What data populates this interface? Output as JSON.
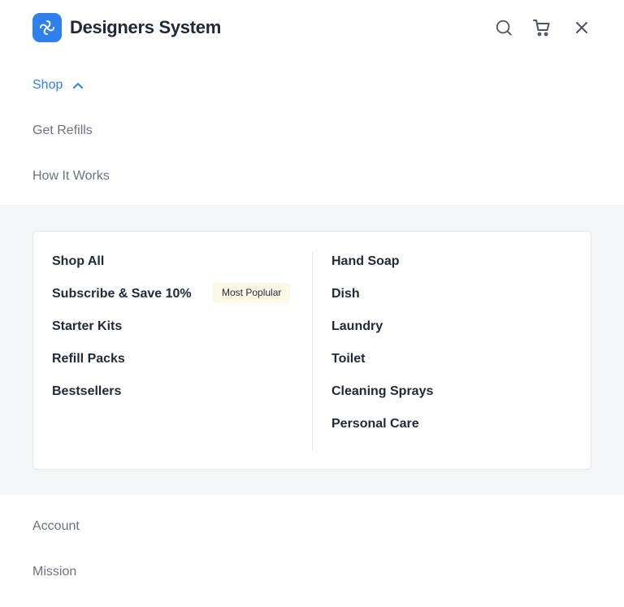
{
  "header": {
    "brand": "Designers System",
    "icons": [
      "logo-icon",
      "search-icon",
      "cart-icon",
      "close-icon"
    ]
  },
  "nav": {
    "shop": "Shop",
    "get_refills": "Get Refills",
    "how_it_works": "How It Works",
    "account": "Account",
    "mission": "Mission"
  },
  "menu": {
    "left": [
      "Shop All",
      "Subscribe & Save 10%",
      "Starter Kits",
      "Refill Packs",
      "Bestsellers"
    ],
    "badge": "Most Poplular",
    "right": [
      "Hand Soap",
      "Dish",
      "Laundry",
      "Toilet",
      "Cleaning Sprays",
      "Personal Care"
    ]
  },
  "colors": {
    "accent": "#2f80ed",
    "panel_bg": "#f4f5f7",
    "badge_bg": "#fdf8e6",
    "text_dark": "#1f2937",
    "text_muted": "#6b7280"
  }
}
